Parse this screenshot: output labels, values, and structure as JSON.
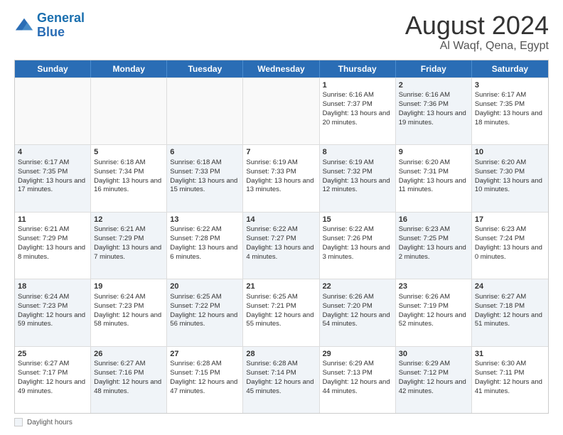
{
  "header": {
    "logo_line1": "General",
    "logo_line2": "Blue",
    "month": "August 2024",
    "location": "Al Waqf, Qena, Egypt"
  },
  "days_of_week": [
    "Sunday",
    "Monday",
    "Tuesday",
    "Wednesday",
    "Thursday",
    "Friday",
    "Saturday"
  ],
  "legend": {
    "label": "Daylight hours"
  },
  "weeks": [
    [
      {
        "day": "",
        "info": "",
        "shaded": false
      },
      {
        "day": "",
        "info": "",
        "shaded": false
      },
      {
        "day": "",
        "info": "",
        "shaded": false
      },
      {
        "day": "",
        "info": "",
        "shaded": false
      },
      {
        "day": "1",
        "info": "Sunrise: 6:16 AM\nSunset: 7:37 PM\nDaylight: 13 hours and 20 minutes.",
        "shaded": false
      },
      {
        "day": "2",
        "info": "Sunrise: 6:16 AM\nSunset: 7:36 PM\nDaylight: 13 hours and 19 minutes.",
        "shaded": true
      },
      {
        "day": "3",
        "info": "Sunrise: 6:17 AM\nSunset: 7:35 PM\nDaylight: 13 hours and 18 minutes.",
        "shaded": false
      }
    ],
    [
      {
        "day": "4",
        "info": "Sunrise: 6:17 AM\nSunset: 7:35 PM\nDaylight: 13 hours and 17 minutes.",
        "shaded": true
      },
      {
        "day": "5",
        "info": "Sunrise: 6:18 AM\nSunset: 7:34 PM\nDaylight: 13 hours and 16 minutes.",
        "shaded": false
      },
      {
        "day": "6",
        "info": "Sunrise: 6:18 AM\nSunset: 7:33 PM\nDaylight: 13 hours and 15 minutes.",
        "shaded": true
      },
      {
        "day": "7",
        "info": "Sunrise: 6:19 AM\nSunset: 7:33 PM\nDaylight: 13 hours and 13 minutes.",
        "shaded": false
      },
      {
        "day": "8",
        "info": "Sunrise: 6:19 AM\nSunset: 7:32 PM\nDaylight: 13 hours and 12 minutes.",
        "shaded": true
      },
      {
        "day": "9",
        "info": "Sunrise: 6:20 AM\nSunset: 7:31 PM\nDaylight: 13 hours and 11 minutes.",
        "shaded": false
      },
      {
        "day": "10",
        "info": "Sunrise: 6:20 AM\nSunset: 7:30 PM\nDaylight: 13 hours and 10 minutes.",
        "shaded": true
      }
    ],
    [
      {
        "day": "11",
        "info": "Sunrise: 6:21 AM\nSunset: 7:29 PM\nDaylight: 13 hours and 8 minutes.",
        "shaded": false
      },
      {
        "day": "12",
        "info": "Sunrise: 6:21 AM\nSunset: 7:29 PM\nDaylight: 13 hours and 7 minutes.",
        "shaded": true
      },
      {
        "day": "13",
        "info": "Sunrise: 6:22 AM\nSunset: 7:28 PM\nDaylight: 13 hours and 6 minutes.",
        "shaded": false
      },
      {
        "day": "14",
        "info": "Sunrise: 6:22 AM\nSunset: 7:27 PM\nDaylight: 13 hours and 4 minutes.",
        "shaded": true
      },
      {
        "day": "15",
        "info": "Sunrise: 6:22 AM\nSunset: 7:26 PM\nDaylight: 13 hours and 3 minutes.",
        "shaded": false
      },
      {
        "day": "16",
        "info": "Sunrise: 6:23 AM\nSunset: 7:25 PM\nDaylight: 13 hours and 2 minutes.",
        "shaded": true
      },
      {
        "day": "17",
        "info": "Sunrise: 6:23 AM\nSunset: 7:24 PM\nDaylight: 13 hours and 0 minutes.",
        "shaded": false
      }
    ],
    [
      {
        "day": "18",
        "info": "Sunrise: 6:24 AM\nSunset: 7:23 PM\nDaylight: 12 hours and 59 minutes.",
        "shaded": true
      },
      {
        "day": "19",
        "info": "Sunrise: 6:24 AM\nSunset: 7:23 PM\nDaylight: 12 hours and 58 minutes.",
        "shaded": false
      },
      {
        "day": "20",
        "info": "Sunrise: 6:25 AM\nSunset: 7:22 PM\nDaylight: 12 hours and 56 minutes.",
        "shaded": true
      },
      {
        "day": "21",
        "info": "Sunrise: 6:25 AM\nSunset: 7:21 PM\nDaylight: 12 hours and 55 minutes.",
        "shaded": false
      },
      {
        "day": "22",
        "info": "Sunrise: 6:26 AM\nSunset: 7:20 PM\nDaylight: 12 hours and 54 minutes.",
        "shaded": true
      },
      {
        "day": "23",
        "info": "Sunrise: 6:26 AM\nSunset: 7:19 PM\nDaylight: 12 hours and 52 minutes.",
        "shaded": false
      },
      {
        "day": "24",
        "info": "Sunrise: 6:27 AM\nSunset: 7:18 PM\nDaylight: 12 hours and 51 minutes.",
        "shaded": true
      }
    ],
    [
      {
        "day": "25",
        "info": "Sunrise: 6:27 AM\nSunset: 7:17 PM\nDaylight: 12 hours and 49 minutes.",
        "shaded": false
      },
      {
        "day": "26",
        "info": "Sunrise: 6:27 AM\nSunset: 7:16 PM\nDaylight: 12 hours and 48 minutes.",
        "shaded": true
      },
      {
        "day": "27",
        "info": "Sunrise: 6:28 AM\nSunset: 7:15 PM\nDaylight: 12 hours and 47 minutes.",
        "shaded": false
      },
      {
        "day": "28",
        "info": "Sunrise: 6:28 AM\nSunset: 7:14 PM\nDaylight: 12 hours and 45 minutes.",
        "shaded": true
      },
      {
        "day": "29",
        "info": "Sunrise: 6:29 AM\nSunset: 7:13 PM\nDaylight: 12 hours and 44 minutes.",
        "shaded": false
      },
      {
        "day": "30",
        "info": "Sunrise: 6:29 AM\nSunset: 7:12 PM\nDaylight: 12 hours and 42 minutes.",
        "shaded": true
      },
      {
        "day": "31",
        "info": "Sunrise: 6:30 AM\nSunset: 7:11 PM\nDaylight: 12 hours and 41 minutes.",
        "shaded": false
      }
    ]
  ]
}
